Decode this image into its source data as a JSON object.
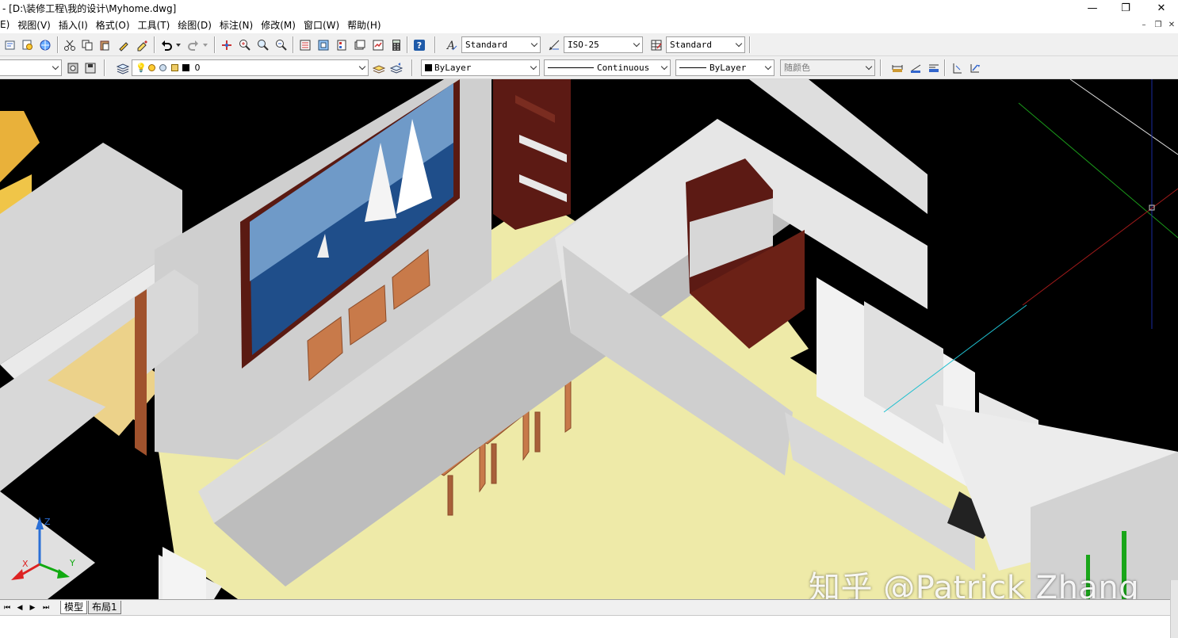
{
  "titlebar": {
    "title": "- [D:\\装修工程\\我的设计\\Myhome.dwg]",
    "minimize": "—",
    "restore": "❐",
    "close": "✕"
  },
  "menubar": {
    "items": [
      "E)",
      "视图(V)",
      "插入(I)",
      "格式(O)",
      "工具(T)",
      "绘图(D)",
      "标注(N)",
      "修改(M)",
      "窗口(W)",
      "帮助(H)"
    ],
    "mdi_minimize": "–",
    "mdi_restore": "❐",
    "mdi_close": "✕"
  },
  "styles_toolbar": {
    "text_style": "Standard",
    "dim_style": "ISO-25",
    "table_style": "Standard"
  },
  "layers_toolbar": {
    "current_layer": "0"
  },
  "properties_toolbar": {
    "color": "ByLayer",
    "linetype": "Continuous",
    "lineweight": "ByLayer",
    "plot_style": "随颜色"
  },
  "viewport": {
    "watermark": "知乎 @Patrick Zhang",
    "ucs_labels": {
      "x": "X",
      "y": "Y",
      "z": "Z"
    }
  },
  "layout_tabs": {
    "nav": [
      "⏮",
      "◀",
      "▶",
      "⏭"
    ],
    "tabs": [
      {
        "label": "模型",
        "active": true
      },
      {
        "label": "布局1",
        "active": false
      }
    ]
  },
  "colors": {
    "floor_yellow": "#eeeaa8",
    "wall_gray": "#e2e2e2",
    "wood_brown": "#6b2116",
    "table_tan": "#e9c57f",
    "chair_orange": "#c87a4a",
    "viewport_bg": "#000000"
  }
}
